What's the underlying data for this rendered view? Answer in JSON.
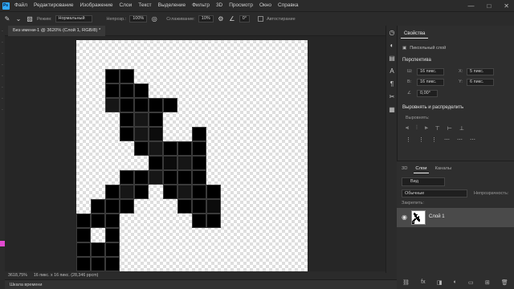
{
  "menu": {
    "logo": "Ps",
    "items": [
      "Файл",
      "Редактирование",
      "Изображение",
      "Слои",
      "Текст",
      "Выделение",
      "Фильтр",
      "3D",
      "Просмотр",
      "Окно",
      "Справка"
    ],
    "controls": [
      "—",
      "□",
      "✕"
    ]
  },
  "options": {
    "mode_label": "Режим:",
    "mode_value": "Нормальный",
    "opacity_label": "Непрозр.:",
    "opacity_value": "100%",
    "smoothing_label": "Сглаживание:",
    "smoothing_value": "10%",
    "angle_value": "0°",
    "autoerase_label": "Автостирание"
  },
  "document": {
    "tab_label": "Без имени-1 @ 3620% (Слой 1, RGB/8) *",
    "zoom": "3618,75%",
    "size": "16 пикс. x 16 пикс. (28,346 ppcm)"
  },
  "canvas": {
    "grid_size": 16,
    "pixels": [
      [
        2,
        2,
        "#000000"
      ],
      [
        3,
        2,
        "#000000"
      ],
      [
        2,
        3,
        "#000000"
      ],
      [
        3,
        3,
        "#000000"
      ],
      [
        4,
        3,
        "#000000"
      ],
      [
        2,
        4,
        "#161616"
      ],
      [
        3,
        4,
        "#000000"
      ],
      [
        4,
        4,
        "#000000"
      ],
      [
        5,
        4,
        "#000000"
      ],
      [
        6,
        4,
        "#000000"
      ],
      [
        3,
        5,
        "#000000"
      ],
      [
        4,
        5,
        "#161616"
      ],
      [
        5,
        5,
        "#000000"
      ],
      [
        3,
        6,
        "#000000"
      ],
      [
        4,
        6,
        "#161616"
      ],
      [
        5,
        6,
        "#0c0c0c"
      ],
      [
        8,
        6,
        "#000000"
      ],
      [
        4,
        7,
        "#000000"
      ],
      [
        5,
        7,
        "#161616"
      ],
      [
        6,
        7,
        "#000000"
      ],
      [
        7,
        7,
        "#000000"
      ],
      [
        8,
        7,
        "#000000"
      ],
      [
        5,
        8,
        "#000000"
      ],
      [
        6,
        8,
        "#0c0c0c"
      ],
      [
        7,
        8,
        "#161616"
      ],
      [
        8,
        8,
        "#000000"
      ],
      [
        3,
        9,
        "#000000"
      ],
      [
        4,
        9,
        "#000000"
      ],
      [
        5,
        9,
        "#161616"
      ],
      [
        6,
        9,
        "#000000"
      ],
      [
        7,
        9,
        "#000000"
      ],
      [
        8,
        9,
        "#000000"
      ],
      [
        2,
        10,
        "#000000"
      ],
      [
        3,
        10,
        "#161616"
      ],
      [
        4,
        10,
        "#000000"
      ],
      [
        6,
        10,
        "#000000"
      ],
      [
        7,
        10,
        "#161616"
      ],
      [
        8,
        10,
        "#000000"
      ],
      [
        9,
        10,
        "#000000"
      ],
      [
        1,
        11,
        "#000000"
      ],
      [
        2,
        11,
        "#000000"
      ],
      [
        3,
        11,
        "#000000"
      ],
      [
        7,
        11,
        "#000000"
      ],
      [
        8,
        11,
        "#000000"
      ],
      [
        9,
        11,
        "#0c0c0c"
      ],
      [
        0,
        12,
        "#000000"
      ],
      [
        1,
        12,
        "#000000"
      ],
      [
        2,
        12,
        "#000000"
      ],
      [
        8,
        12,
        "#000000"
      ],
      [
        9,
        12,
        "#000000"
      ],
      [
        0,
        13,
        "#000000"
      ],
      [
        2,
        13,
        "#000000"
      ],
      [
        0,
        14,
        "#000000"
      ],
      [
        1,
        14,
        "#000000"
      ],
      [
        2,
        14,
        "#000000"
      ],
      [
        0,
        15,
        "#000000"
      ],
      [
        1,
        15,
        "#000000"
      ],
      [
        2,
        15,
        "#000000"
      ]
    ]
  },
  "timeline": {
    "label": "Шкала времени"
  },
  "properties": {
    "tab": "Свойства",
    "subtitle": "Пиксельный слой",
    "perspective_title": "Перспектива",
    "w_label": "Ш:",
    "w_value": "16 пикс.",
    "h_label": "В:",
    "h_value": "16 пикс.",
    "x_label": "X:",
    "x_value": "5 пикс.",
    "y_label": "Y:",
    "y_value": "6 пикс.",
    "angle_value": "0,00°",
    "align_title": "Выровнять и распределить",
    "align_label": "Выровнять:"
  },
  "layers": {
    "tabs": [
      "3D",
      "Слои",
      "Каналы"
    ],
    "search": "Вид",
    "blend_mode": "Обычные",
    "opacity_label": "Непрозрачность:",
    "lock_label": "Закрепить:",
    "layer_name": "Слой 1"
  }
}
